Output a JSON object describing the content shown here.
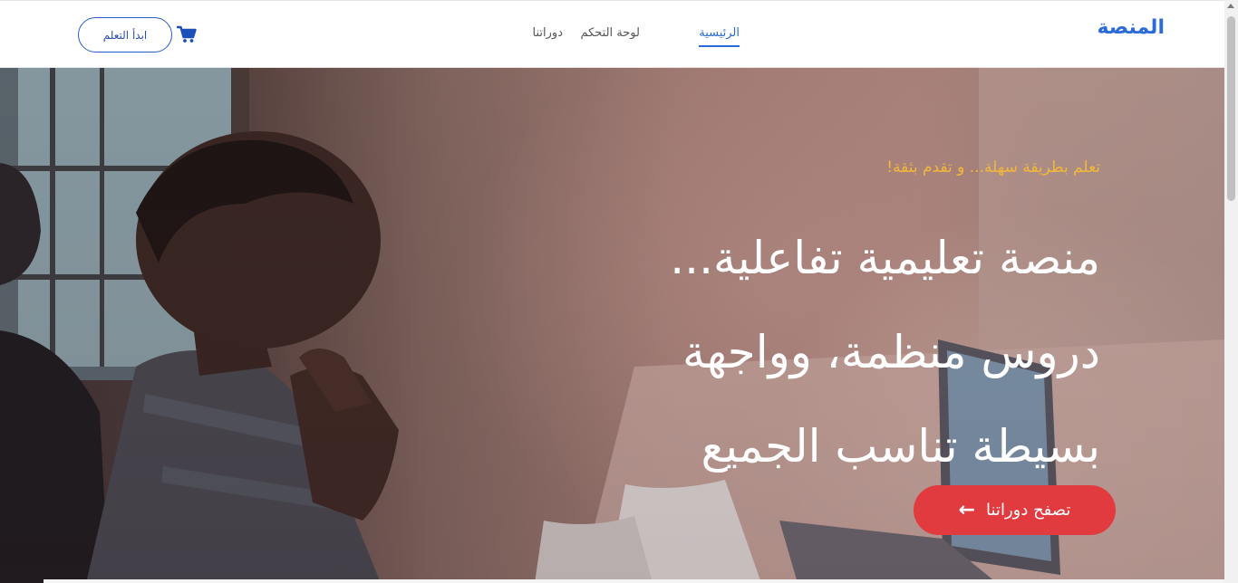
{
  "navbar": {
    "brand": "المنصة",
    "links": [
      {
        "label": "الرئيسية",
        "active": true
      },
      {
        "label": "لوحة التحكم",
        "active": false
      },
      {
        "label": "دوراتنا",
        "active": false
      }
    ],
    "cart_icon": "shopping-cart-icon",
    "start_button": "ابدأ التعلم"
  },
  "hero": {
    "tagline": "تعلم بطريقة سهلة... و تقدم بثقة!",
    "headline_lines": [
      "منصة تعليمية تفاعلية...",
      "دروس منظمة، وواجهة",
      "بسيطة تناسب الجميع"
    ],
    "cta_button": "تصفح دوراتنا",
    "cta_icon": "arrow-left-icon"
  },
  "colors": {
    "brand": "#2a6bd8",
    "tagline": "#f2b83a",
    "cta": "#e23b3f"
  }
}
